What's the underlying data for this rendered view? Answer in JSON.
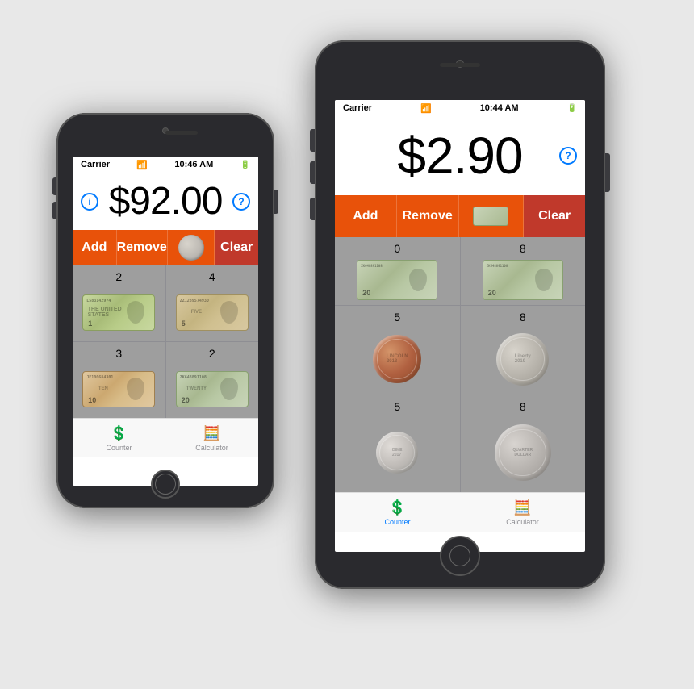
{
  "phones": {
    "small": {
      "carrier": "Carrier",
      "time": "10:46 AM",
      "battery": "■■■",
      "amount": "$92.00",
      "buttons": {
        "add": "Add",
        "remove": "Remove",
        "clear": "Clear"
      },
      "cells": [
        {
          "count": "2",
          "type": "bill-1",
          "denom": "1",
          "serial": "L583142974"
        },
        {
          "count": "4",
          "type": "bill-5",
          "denom": "5",
          "serial": "ZZ1289574930"
        },
        {
          "count": "3",
          "type": "bill-10",
          "denom": "10",
          "serial": "JF100684301"
        },
        {
          "count": "2",
          "type": "bill-20",
          "denom": "20",
          "serial": "ZK648891108"
        }
      ],
      "nav": {
        "counter": "Counter",
        "calculator": "Calculator"
      }
    },
    "large": {
      "carrier": "Carrier",
      "time": "10:44 AM",
      "battery": "■■",
      "amount": "$2.90",
      "buttons": {
        "add": "Add",
        "remove": "Remove",
        "clear": "Clear"
      },
      "cells": [
        {
          "count": "0",
          "type": "bill-20-top",
          "denom": "20"
        },
        {
          "count": "8",
          "type": "bill-20-top",
          "denom": "20"
        },
        {
          "count": "5",
          "type": "coin-penny"
        },
        {
          "count": "8",
          "type": "coin-nickel"
        },
        {
          "count": "5",
          "type": "coin-dime"
        },
        {
          "count": "8",
          "type": "coin-quarter"
        }
      ],
      "nav": {
        "counter": "Counter",
        "calculator": "Calculator"
      }
    }
  }
}
